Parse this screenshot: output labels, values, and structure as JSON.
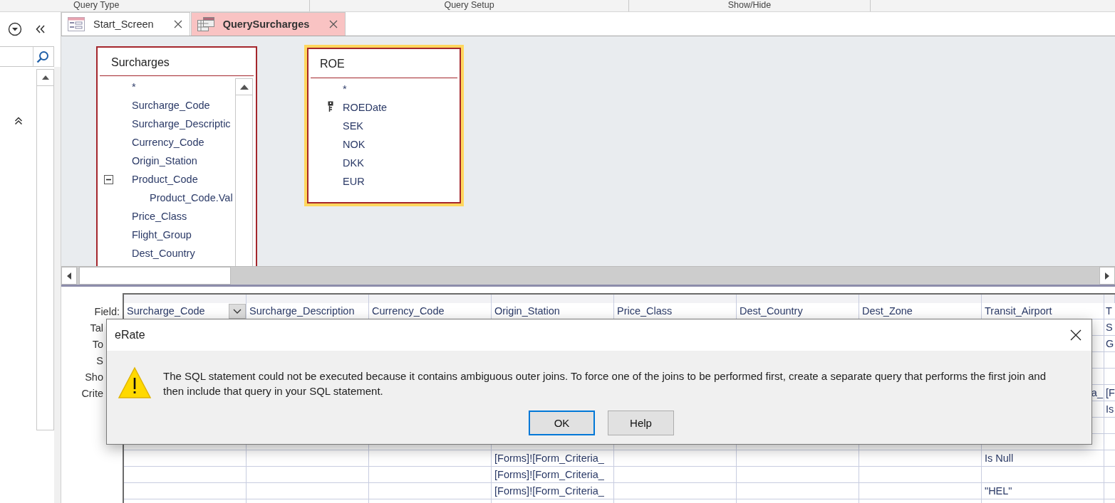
{
  "ribbon": {
    "groups": [
      "Query Type",
      "Query Setup",
      "Show/Hide"
    ]
  },
  "tabs": [
    {
      "label": "Start_Screen",
      "kind": "form",
      "selected": false
    },
    {
      "label": "QuerySurcharges",
      "kind": "query",
      "selected": true
    }
  ],
  "tables": [
    {
      "title": "Surcharges",
      "selected": false,
      "scrollable": true,
      "fields": [
        {
          "label": "*",
          "primary_key": false
        },
        {
          "label": "Surcharge_Code",
          "primary_key": false
        },
        {
          "label": "Surcharge_Descriptic",
          "primary_key": false
        },
        {
          "label": "Currency_Code",
          "primary_key": false
        },
        {
          "label": "Origin_Station",
          "primary_key": false
        },
        {
          "label": "Product_Code",
          "primary_key": false,
          "expanded": true,
          "children": [
            {
              "label": "Product_Code.Val",
              "primary_key": false
            }
          ]
        },
        {
          "label": "Price_Class",
          "primary_key": false
        },
        {
          "label": "Flight_Group",
          "primary_key": false
        },
        {
          "label": "Dest_Country",
          "primary_key": false
        }
      ]
    },
    {
      "title": "ROE",
      "selected": true,
      "scrollable": false,
      "fields": [
        {
          "label": "*",
          "primary_key": false
        },
        {
          "label": "ROEDate",
          "primary_key": true
        },
        {
          "label": "SEK",
          "primary_key": false
        },
        {
          "label": "NOK",
          "primary_key": false
        },
        {
          "label": "DKK",
          "primary_key": false
        },
        {
          "label": "EUR",
          "primary_key": false
        }
      ]
    }
  ],
  "grid": {
    "rows": [
      {
        "label": "Field:",
        "kind": "field",
        "cells": [
          "Surcharge_Code",
          "Surcharge_Description",
          "Currency_Code",
          "Origin_Station",
          "Price_Class",
          "Dest_Country",
          "Dest_Zone",
          "Transit_Airport",
          "T"
        ]
      },
      {
        "label": "Tal",
        "kind": "clipped",
        "cells": [
          null,
          null,
          null,
          null,
          null,
          null,
          null,
          null,
          "S"
        ]
      },
      {
        "label": "To",
        "kind": "clipped",
        "cells": [
          null,
          null,
          null,
          null,
          null,
          null,
          null,
          null,
          "G"
        ]
      },
      {
        "label": "S",
        "kind": "clipped",
        "cells": [
          null,
          null,
          null,
          null,
          null,
          null,
          null,
          null,
          null
        ]
      },
      {
        "label": "Sho",
        "kind": "clipped",
        "cells": [
          null,
          null,
          null,
          null,
          null,
          null,
          null,
          null,
          null
        ]
      },
      {
        "label": "Crite",
        "kind": "clipped",
        "cells": [
          null,
          null,
          null,
          null,
          null,
          null,
          null,
          "a_",
          "[F"
        ]
      },
      {
        "label": null,
        "kind": "clipped",
        "cells": [
          null,
          null,
          null,
          null,
          null,
          null,
          null,
          null,
          "Is"
        ]
      },
      {
        "label": null,
        "kind": "plain",
        "cells": [
          null,
          null,
          null,
          null,
          null,
          null,
          null,
          null,
          null
        ]
      },
      {
        "label": null,
        "kind": "plain",
        "cells": [
          null,
          null,
          null,
          null,
          null,
          null,
          null,
          null,
          null
        ]
      },
      {
        "label": null,
        "kind": "plain",
        "cells": [
          null,
          null,
          null,
          "[Forms]![Form_Criteria_",
          null,
          null,
          null,
          "Is Null",
          null
        ]
      },
      {
        "label": null,
        "kind": "plain",
        "cells": [
          null,
          null,
          null,
          "[Forms]![Form_Criteria_",
          null,
          null,
          null,
          null,
          null
        ]
      },
      {
        "label": null,
        "kind": "plain",
        "cells": [
          null,
          null,
          null,
          "[Forms]![Form_Criteria_",
          null,
          null,
          null,
          "\"HEL\"",
          null
        ]
      },
      {
        "label": null,
        "kind": "plain",
        "cells": [
          null,
          null,
          null,
          null,
          null,
          null,
          null,
          null,
          null
        ]
      }
    ]
  },
  "dialog": {
    "title": "eRate",
    "message": "The SQL statement could not be executed because it contains ambiguous outer joins. To force one of the joins to be performed first, create a separate query that performs the first join and then include that query in your SQL statement.",
    "buttons": [
      {
        "label": "OK",
        "default": true
      },
      {
        "label": "Help",
        "default": false
      }
    ]
  }
}
